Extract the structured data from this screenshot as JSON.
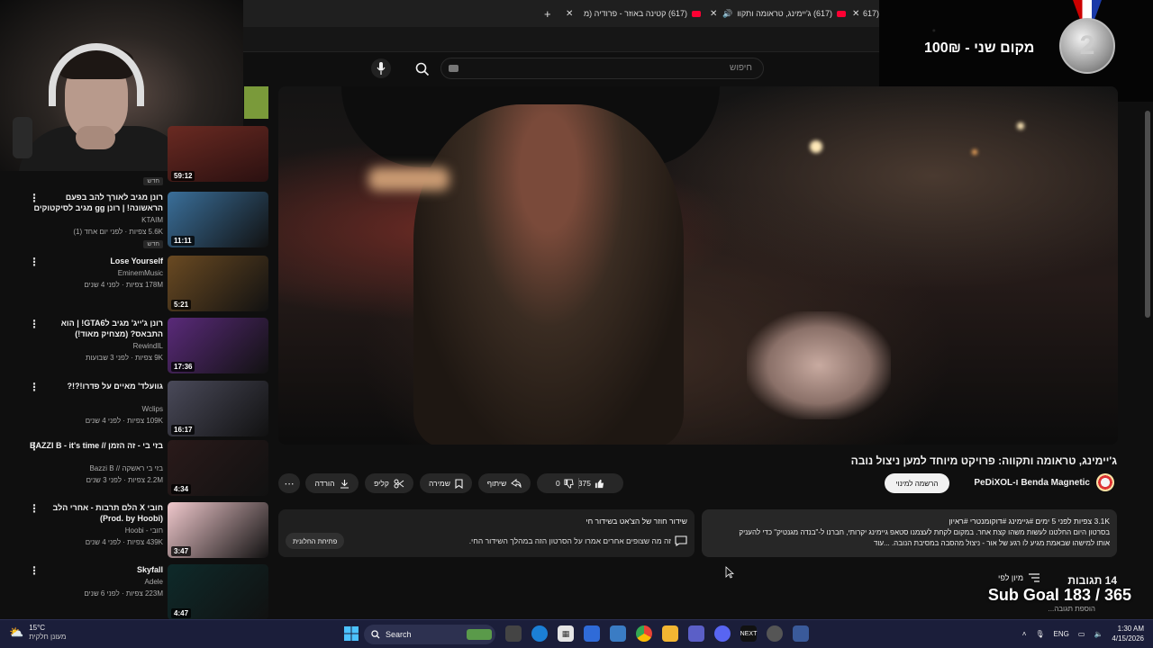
{
  "tabs": [
    {
      "title": "(617) ג'יימינג, טראומה ותקוו",
      "active": true
    },
    {
      "title": "(617) קטינה באוזר - פרודיה (מ",
      "active": false
    },
    {
      "title": "(617",
      "active": false
    }
  ],
  "search": {
    "placeholder": "חיפוש"
  },
  "overlay": {
    "prize_text": "מקום שני - 100₪",
    "medal_number": "2",
    "webcam_duration": "59:12"
  },
  "sidebar": {
    "items": [
      {
        "title": "רונן מגיב לאורך להב בפעם הראשונה! | רונן gg מגיב לסיקטוקים",
        "channel": "KTAIM",
        "meta": "5.6K צפיות · לפני יום אחד (1)",
        "badge": "חדש",
        "duration": "11:11",
        "thumb_color": "#3a6f9a"
      },
      {
        "title": "Lose Yourself",
        "channel": "EminemMusic",
        "meta": "178M צפיות · לפני 4 שנים",
        "badge": "",
        "duration": "5:21",
        "thumb_color": "#6a4a22"
      },
      {
        "title": "רונן ג'ייג' מגיב לGTA6! | הוא התבאס? (מצחיק מאוד!)",
        "channel": "RewindIL",
        "meta": "9K צפיות · לפני 3 שבועות",
        "badge": "",
        "duration": "17:36",
        "thumb_color": "#5a2a7a"
      },
      {
        "title": "גוועלד' מאיים על פדרו!?!?",
        "channel": "Wclips",
        "meta": "109K צפיות · לפני 4 שנים",
        "badge": "",
        "duration": "16:17",
        "thumb_color": "#4a4a5a"
      },
      {
        "title": "בזי בי - זה הזמן // BAZZI B - it's time",
        "channel": "בזי בי ראשקה // Bazzi B",
        "meta": "2.2M צפיות · לפני 3 שנים",
        "badge": "",
        "duration": "4:34",
        "thumb_color": "#2a1a1a"
      },
      {
        "title": "חובי X הלם תרבות - אחרי הלב (Prod. by Hoobi)",
        "channel": "חובי - Hoobi",
        "meta": "439K צפיות · לפני 4 שנים",
        "badge": "",
        "duration": "3:47",
        "thumb_color": "#f0c8cc"
      },
      {
        "title": "Skyfall",
        "channel": "Adele",
        "meta": "223M צפיות · לפני 6 שנים",
        "badge": "",
        "duration": "4:47",
        "thumb_color": "#0e2a2a"
      }
    ]
  },
  "video": {
    "title": "ג'יימינג, טראומה ותקווה: פרויקט מיוחד למען ניצול נובה",
    "channel": "Benda Magnetic ו-PeDiXOL",
    "subscribe_label": "הרשמה למינוי",
    "likes": "375",
    "dislikes": "0",
    "share_label": "שיתוף",
    "save_label": "שמירה",
    "clip_label": "קליפ",
    "download_label": "הורדה",
    "more_label": "⋯"
  },
  "description": {
    "stats": "3.1K צפיות  לפני 5 ימים  #גיימינג #דוקומנטרי #ראיון",
    "line1": "בסרטון היום החלטנו לעשות משהו קצת אחר. במקום לקחת לעצמנו סטאפ גיימינג יקרותי, חברנו ל-\"בנדה מגנטיק\" כדי להעניק",
    "line2": "אותו למישהו שבאמת מגיע לו רגע של אור - ניצול מהסבה במסיבת הנובה. ...עוד"
  },
  "live_chat": {
    "title": "שידור חוזר של הצ'אט בשידור חי",
    "subtitle": "זה מה שצופים אחרים אמרו על הסרטון הזה במהלך השידור החי.",
    "open_label": "פתיחת החלונית"
  },
  "comments": {
    "count_label": "14 תגובות",
    "sort_label": "מיון לפי",
    "add_placeholder": "הוספת תגובה...",
    "sub_goal": "Sub Goal 183 / 365"
  },
  "taskbar": {
    "temp": "15°C",
    "weather_desc": "מעונן חלקית",
    "search_label": "Search",
    "lang": "ENG",
    "time": "1:30 AM",
    "date": "4/15/2026"
  }
}
